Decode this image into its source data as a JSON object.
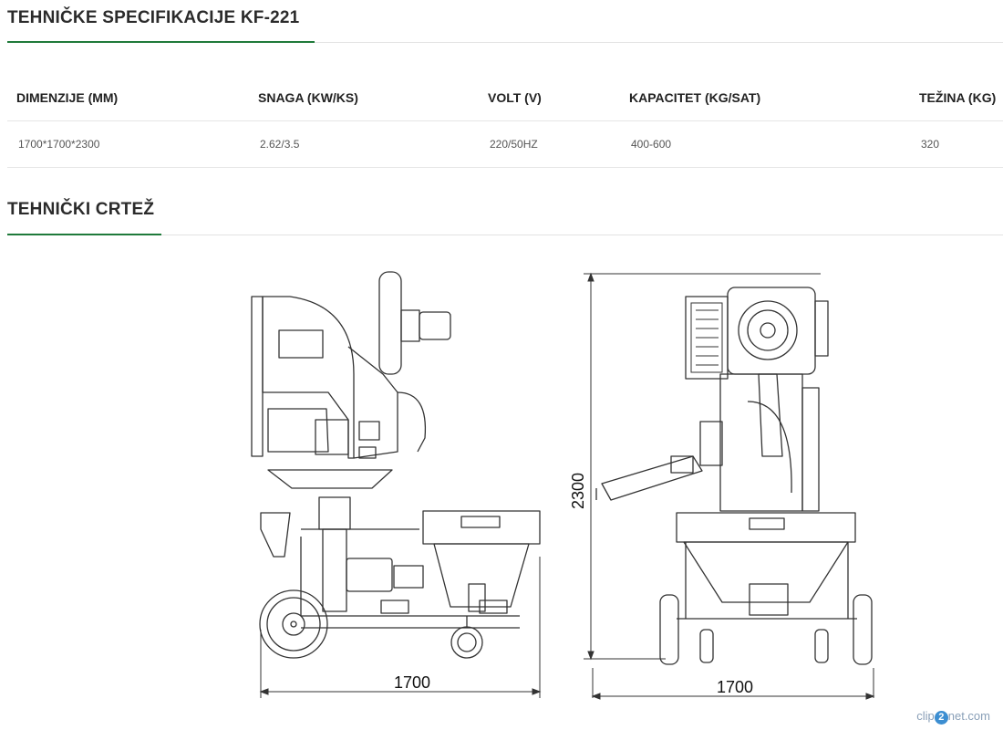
{
  "specs": {
    "title": "TEHNIČKE SPECIFIKACIJE KF-221",
    "headers": [
      "DIMENZIJE (MM)",
      "SNAGA (KW/KS)",
      "VOLT (V)",
      "KAPACITET (KG/SAT)",
      "TEŽINA (KG)"
    ],
    "values": [
      "1700*1700*2300",
      "2.62/3.5",
      "220/50HZ",
      "400-600",
      "320"
    ]
  },
  "drawing": {
    "title": "TEHNIČKI CRTEŽ",
    "side_width_label": "1700",
    "front_width_label": "1700",
    "height_label": "2300"
  },
  "watermark": {
    "prefix": "clip",
    "mark": "2",
    "suffix": "net.com"
  },
  "colors": {
    "accent": "#1f7a3a",
    "text": "#222222",
    "muted": "#555555",
    "rule": "#e3e3e3"
  }
}
